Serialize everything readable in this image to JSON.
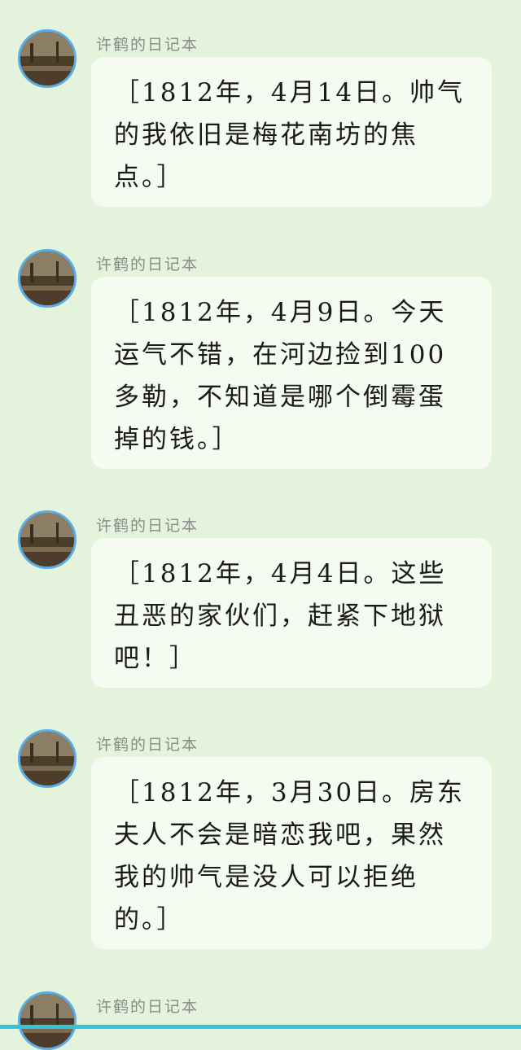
{
  "messages": [
    {
      "sender": "许鹤的日记本",
      "avatar_icon": "landscape-painting-icon",
      "text": "［1812年，4月14日。帅气的我依旧是梅花南坊的焦点。］"
    },
    {
      "sender": "许鹤的日记本",
      "avatar_icon": "landscape-painting-icon",
      "text": "［1812年，4月9日。今天运气不错，在河边捡到100多勒，不知道是哪个倒霉蛋掉的钱。］"
    },
    {
      "sender": "许鹤的日记本",
      "avatar_icon": "landscape-painting-icon",
      "text": "［1812年，4月4日。这些丑恶的家伙们，赶紧下地狱吧！］"
    },
    {
      "sender": "许鹤的日记本",
      "avatar_icon": "landscape-painting-icon",
      "text": "［1812年，3月30日。房东夫人不会是暗恋我吧，果然我的帅气是没人可以拒绝的。］"
    },
    {
      "sender": "许鹤的日记本",
      "avatar_icon": "landscape-painting-icon",
      "text": ""
    }
  ],
  "colors": {
    "background": "#e3f3dc",
    "bubble": "#f6fbf2",
    "avatar_ring": "#5aaee6",
    "bottom_bar": "#34c4d8"
  }
}
